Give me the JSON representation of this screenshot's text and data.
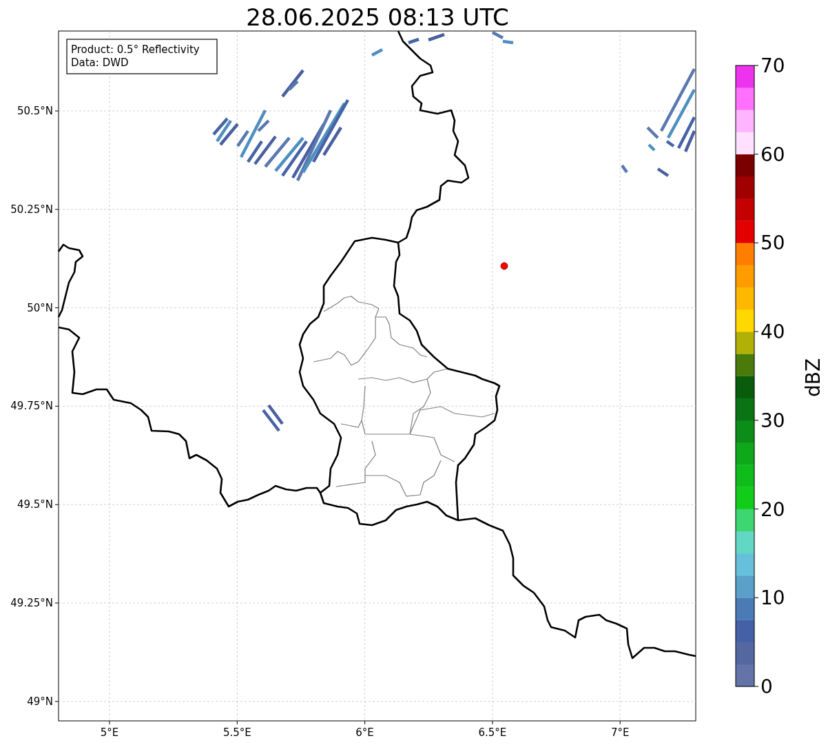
{
  "title": "28.06.2025 08:13 UTC",
  "info_box": [
    "Product: 0.5° Reflectivity",
    "Data: DWD"
  ],
  "x_axis": {
    "ticks": [
      "5°E",
      "5.5°E",
      "6°E",
      "6.5°E",
      "7°E"
    ]
  },
  "y_axis": {
    "ticks": [
      "50.5°N",
      "50.25°N",
      "50°N",
      "49.75°N",
      "49.5°N",
      "49.25°N",
      "49°N"
    ]
  },
  "colorbar": {
    "label": "dBZ",
    "ticks": [
      "70",
      "60",
      "50",
      "40",
      "30",
      "20",
      "10",
      "0"
    ],
    "bands": [
      {
        "color": "#6473a8"
      },
      {
        "color": "#5467a0"
      },
      {
        "color": "#4460a6"
      },
      {
        "color": "#4a7bb4"
      },
      {
        "color": "#5aa0c8"
      },
      {
        "color": "#66c0dc"
      },
      {
        "color": "#62d8c4"
      },
      {
        "color": "#3dd670"
      },
      {
        "color": "#12cc1a"
      },
      {
        "color": "#10bc1c"
      },
      {
        "color": "#0ea81a"
      },
      {
        "color": "#0c8c18"
      },
      {
        "color": "#0a7414"
      },
      {
        "color": "#085c0c"
      },
      {
        "color": "#4a7a0a"
      },
      {
        "color": "#b0b006"
      },
      {
        "color": "#ffd800"
      },
      {
        "color": "#ffb800"
      },
      {
        "color": "#ff9c00"
      },
      {
        "color": "#ff7e00"
      },
      {
        "color": "#e40000"
      },
      {
        "color": "#c40000"
      },
      {
        "color": "#a00000"
      },
      {
        "color": "#7a0000"
      },
      {
        "color": "#ffe0ff"
      },
      {
        "color": "#ffb4ff"
      },
      {
        "color": "#ff70ff"
      },
      {
        "color": "#ee33ee"
      }
    ]
  }
}
